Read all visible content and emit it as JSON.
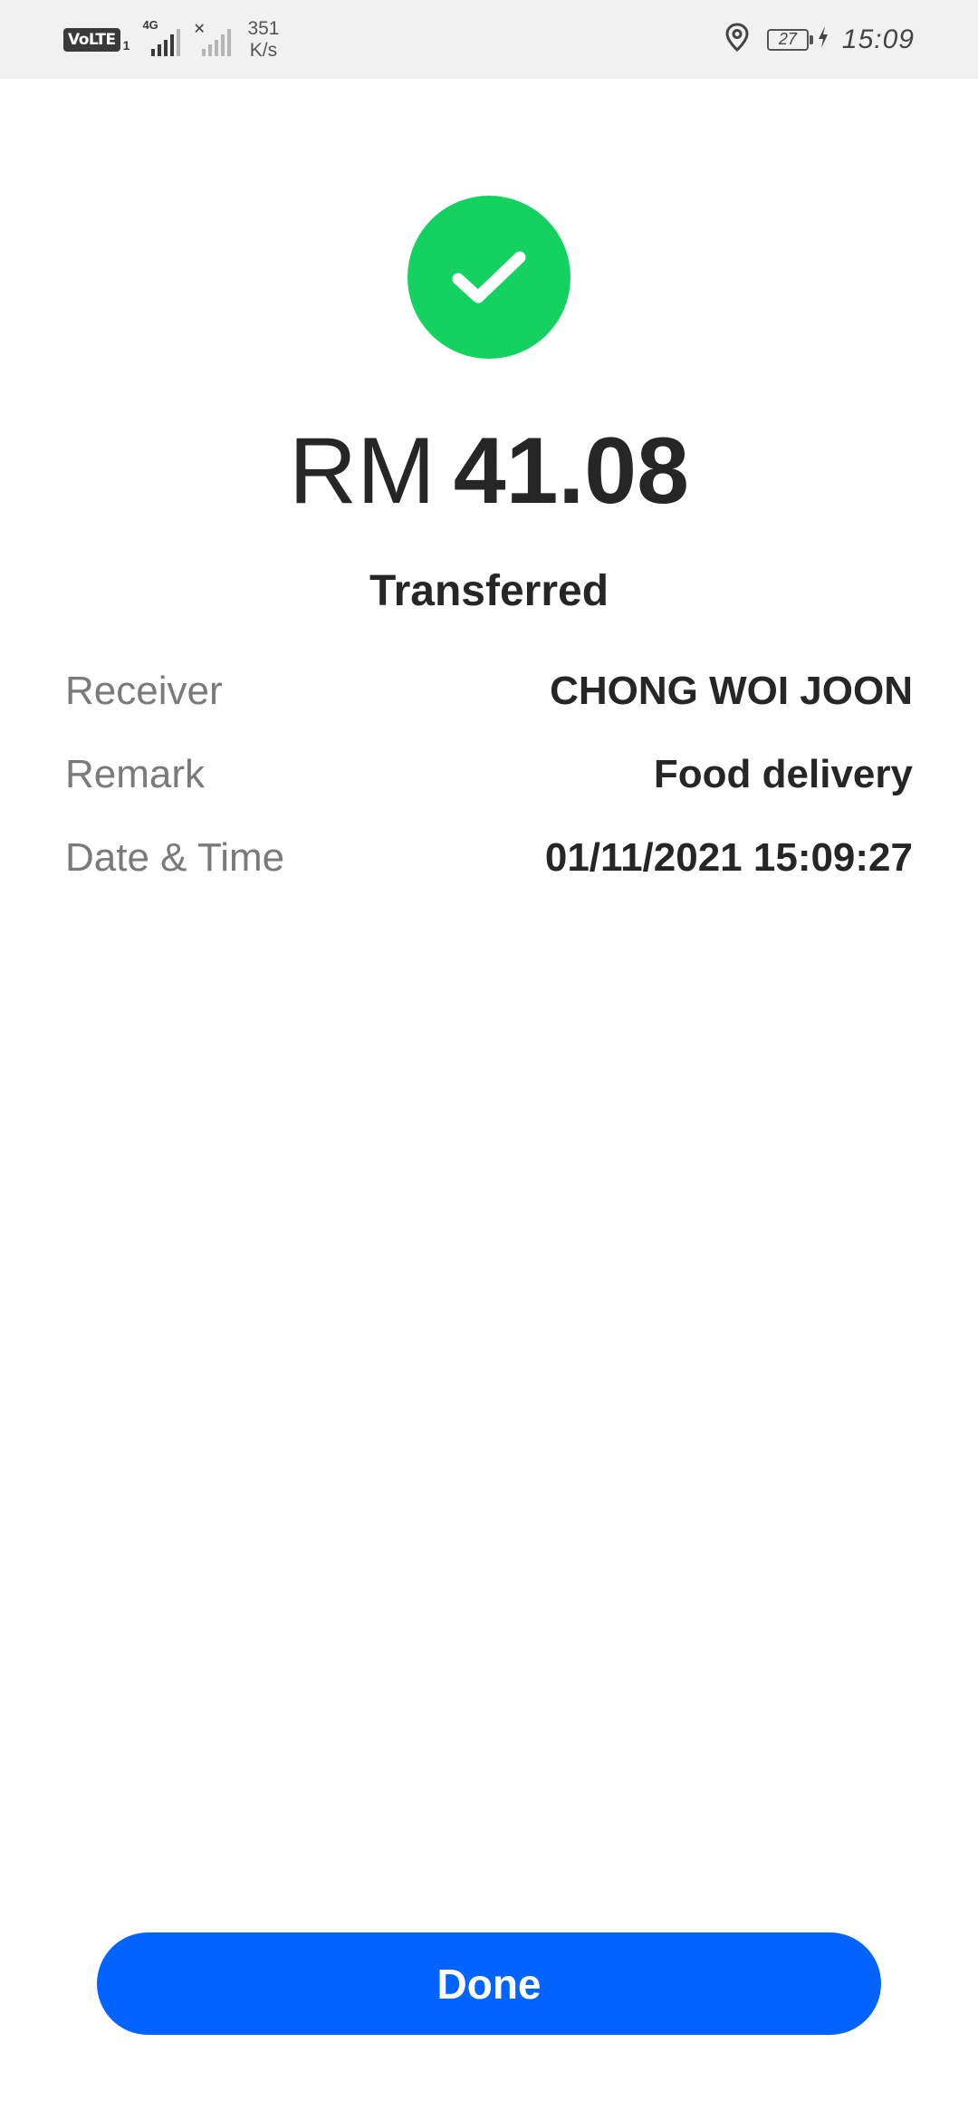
{
  "status_bar": {
    "volte_label": "VoLTE",
    "sim_slot": "1",
    "network_type": "4G",
    "network_speed_value": "351",
    "network_speed_unit": "K/s",
    "battery_level": "27",
    "time": "15:09",
    "icons": [
      "location-icon",
      "battery-icon",
      "charging-icon",
      "signal-icon"
    ]
  },
  "result": {
    "status_icon": "check-icon",
    "status_color": "#13d25f",
    "currency": "RM",
    "amount": "41.08",
    "status_text": "Transferred"
  },
  "details": [
    {
      "label": "Receiver",
      "value": "CHONG WOI JOON"
    },
    {
      "label": "Remark",
      "value": "Food delivery"
    },
    {
      "label": "Date & Time",
      "value": "01/11/2021 15:09:27"
    }
  ],
  "actions": {
    "done_label": "Done",
    "done_color": "#0263ff"
  }
}
